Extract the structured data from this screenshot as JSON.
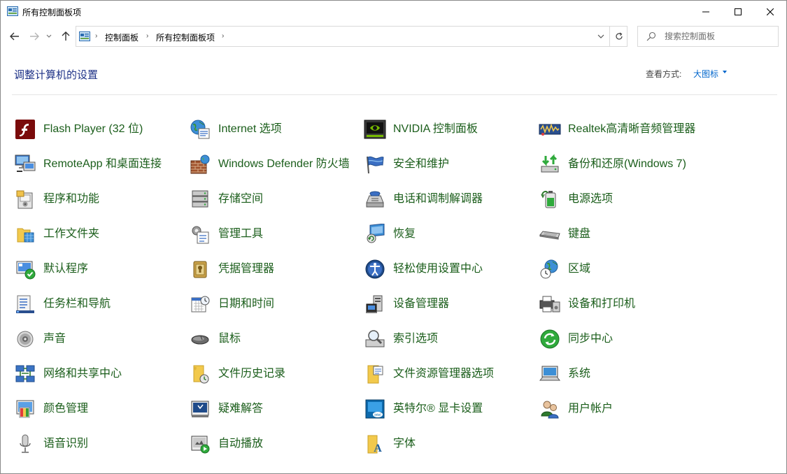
{
  "window": {
    "title": "所有控制面板项"
  },
  "address": {
    "crumbs": [
      "控制面板",
      "所有控制面板项"
    ]
  },
  "search": {
    "placeholder": "搜索控制面板"
  },
  "header": {
    "title": "调整计算机的设置",
    "view_label": "查看方式:",
    "view_value": "大图标"
  },
  "items": [
    {
      "label": "Flash Player (32 位)",
      "icon": "flash-icon"
    },
    {
      "label": "Internet 选项",
      "icon": "globe-icon"
    },
    {
      "label": "NVIDIA 控制面板",
      "icon": "nvidia-icon"
    },
    {
      "label": "Realtek高清晰音频管理器",
      "icon": "audio-manager-icon"
    },
    {
      "label": "RemoteApp 和桌面连接",
      "icon": "remote-desktop-icon"
    },
    {
      "label": "Windows Defender 防火墙",
      "icon": "firewall-icon"
    },
    {
      "label": "安全和维护",
      "icon": "flag-icon"
    },
    {
      "label": "备份和还原(Windows 7)",
      "icon": "backup-icon"
    },
    {
      "label": "程序和功能",
      "icon": "programs-icon"
    },
    {
      "label": "存储空间",
      "icon": "storage-icon"
    },
    {
      "label": "电话和调制解调器",
      "icon": "phone-icon"
    },
    {
      "label": "电源选项",
      "icon": "battery-icon"
    },
    {
      "label": "工作文件夹",
      "icon": "folder-icon"
    },
    {
      "label": "管理工具",
      "icon": "admin-tools-icon"
    },
    {
      "label": "恢复",
      "icon": "recovery-icon"
    },
    {
      "label": "键盘",
      "icon": "keyboard-icon"
    },
    {
      "label": "默认程序",
      "icon": "default-programs-icon"
    },
    {
      "label": "凭据管理器",
      "icon": "credential-icon"
    },
    {
      "label": "轻松使用设置中心",
      "icon": "accessibility-icon"
    },
    {
      "label": "区域",
      "icon": "region-icon"
    },
    {
      "label": "任务栏和导航",
      "icon": "taskbar-icon"
    },
    {
      "label": "日期和时间",
      "icon": "calendar-icon"
    },
    {
      "label": "设备管理器",
      "icon": "device-manager-icon"
    },
    {
      "label": "设备和打印机",
      "icon": "printer-icon"
    },
    {
      "label": "声音",
      "icon": "speaker-icon"
    },
    {
      "label": "鼠标",
      "icon": "mouse-icon"
    },
    {
      "label": "索引选项",
      "icon": "index-icon"
    },
    {
      "label": "同步中心",
      "icon": "sync-icon"
    },
    {
      "label": "网络和共享中心",
      "icon": "network-icon"
    },
    {
      "label": "文件历史记录",
      "icon": "file-history-icon"
    },
    {
      "label": "文件资源管理器选项",
      "icon": "explorer-options-icon"
    },
    {
      "label": "系统",
      "icon": "system-icon"
    },
    {
      "label": "颜色管理",
      "icon": "color-management-icon"
    },
    {
      "label": "疑难解答",
      "icon": "troubleshoot-icon"
    },
    {
      "label": "英特尔® 显卡设置",
      "icon": "intel-graphics-icon"
    },
    {
      "label": "用户帐户",
      "icon": "users-icon"
    },
    {
      "label": "语音识别",
      "icon": "microphone-icon"
    },
    {
      "label": "自动播放",
      "icon": "autoplay-icon"
    },
    {
      "label": "字体",
      "icon": "fonts-icon"
    }
  ]
}
